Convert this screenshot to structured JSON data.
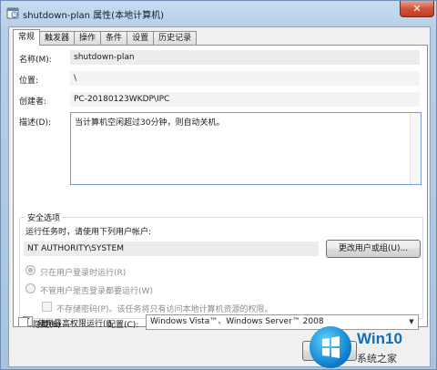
{
  "window": {
    "title": "shutdown-plan 属性(本地计算机)",
    "close_glyph": "✕"
  },
  "tabs": [
    {
      "label": "常规",
      "active": true
    },
    {
      "label": "触发器",
      "active": false
    },
    {
      "label": "操作",
      "active": false
    },
    {
      "label": "条件",
      "active": false
    },
    {
      "label": "设置",
      "active": false
    },
    {
      "label": "历史记录",
      "active": false
    }
  ],
  "general": {
    "name_label": "名称(M):",
    "name_value": "shutdown-plan",
    "location_label": "位置:",
    "location_value": "\\",
    "author_label": "创建者:",
    "author_value": "PC-20180123WKDP\\IPC",
    "description_label": "描述(D):",
    "description_value": "当计算机空闲超过30分钟，则自动关机。"
  },
  "security": {
    "group_title": "安全选项",
    "run_as_prompt": "运行任务时，请使用下列用户帐户:",
    "account_value": "NT AUTHORITY\\SYSTEM",
    "change_user_button": "更改用户或组(U)...",
    "radio_logged_on": "只在用户登录时运行(R)",
    "radio_whether_logged": "不管用户是否登录都要运行(W)",
    "no_store_password": "不存储密码(P)。该任务将只有访问本地计算机资源的权限。",
    "highest_privileges": "使用最高权限运行(I)",
    "highest_privileges_checked": true
  },
  "footer": {
    "hidden_label": "隐藏(E)",
    "hidden_checked": false,
    "configure_label": "配置(C):",
    "configure_value": "Windows Vista™、Windows Server™ 2008"
  },
  "watermark": {
    "title": "Win10",
    "subtitle": "系统之家"
  },
  "colors": {
    "accent": "#0e6fbf",
    "close": "#c23a20"
  }
}
